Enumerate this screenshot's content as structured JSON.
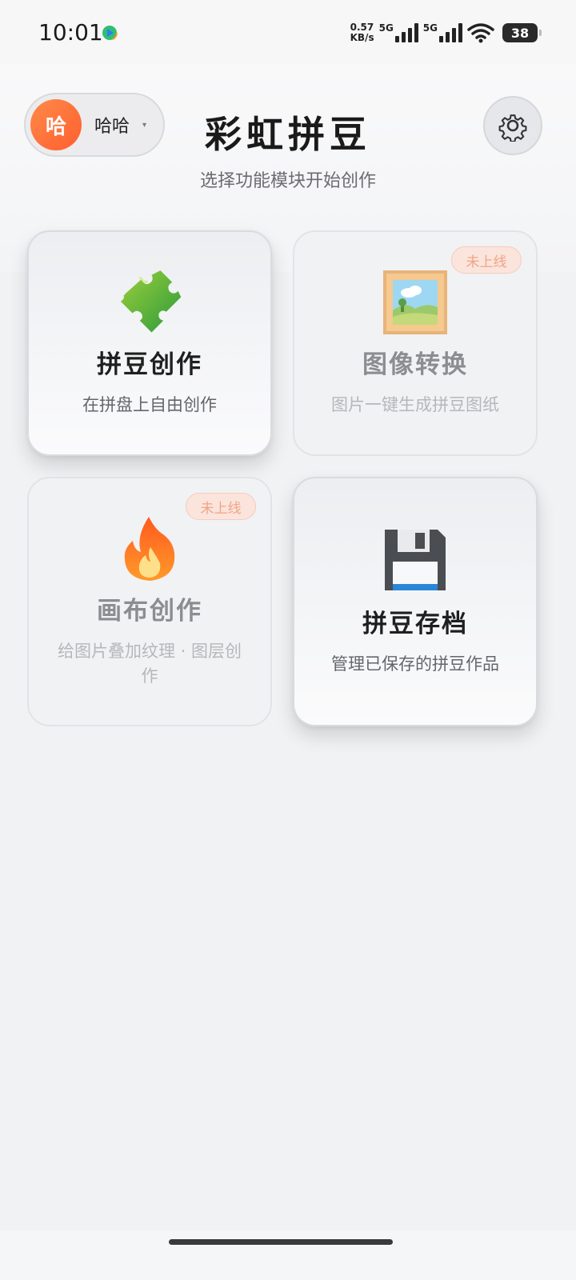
{
  "status_bar": {
    "time": "10:01",
    "speed_value": "0.57",
    "speed_unit": "KB/s",
    "net1": "5G",
    "net2": "5G",
    "battery": "38"
  },
  "header": {
    "user_avatar": "哈",
    "user_name": "哈哈",
    "caret": "▾",
    "title": "彩虹拼豆",
    "subtitle": "选择功能模块开始创作",
    "settings_icon": "gear-icon"
  },
  "cards": [
    {
      "icon": "puzzle-icon",
      "title": "拼豆创作",
      "desc": "在拼盘上自由创作",
      "enabled": true
    },
    {
      "icon": "framed-picture-icon",
      "title": "图像转换",
      "desc": "图片一键生成拼豆图纸",
      "badge": "未上线",
      "enabled": false
    },
    {
      "icon": "fire-icon",
      "title": "画布创作",
      "desc": "给图片叠加纹理 · 图层创作",
      "badge": "未上线",
      "enabled": false
    },
    {
      "icon": "floppy-disk-icon",
      "title": "拼豆存档",
      "desc": "管理已保存的拼豆作品",
      "enabled": true
    }
  ],
  "colors": {
    "accent": "#ff6a34",
    "badge_bg": "#fbe4dc",
    "badge_text": "#f0a486",
    "background": "#f1f2f4"
  }
}
